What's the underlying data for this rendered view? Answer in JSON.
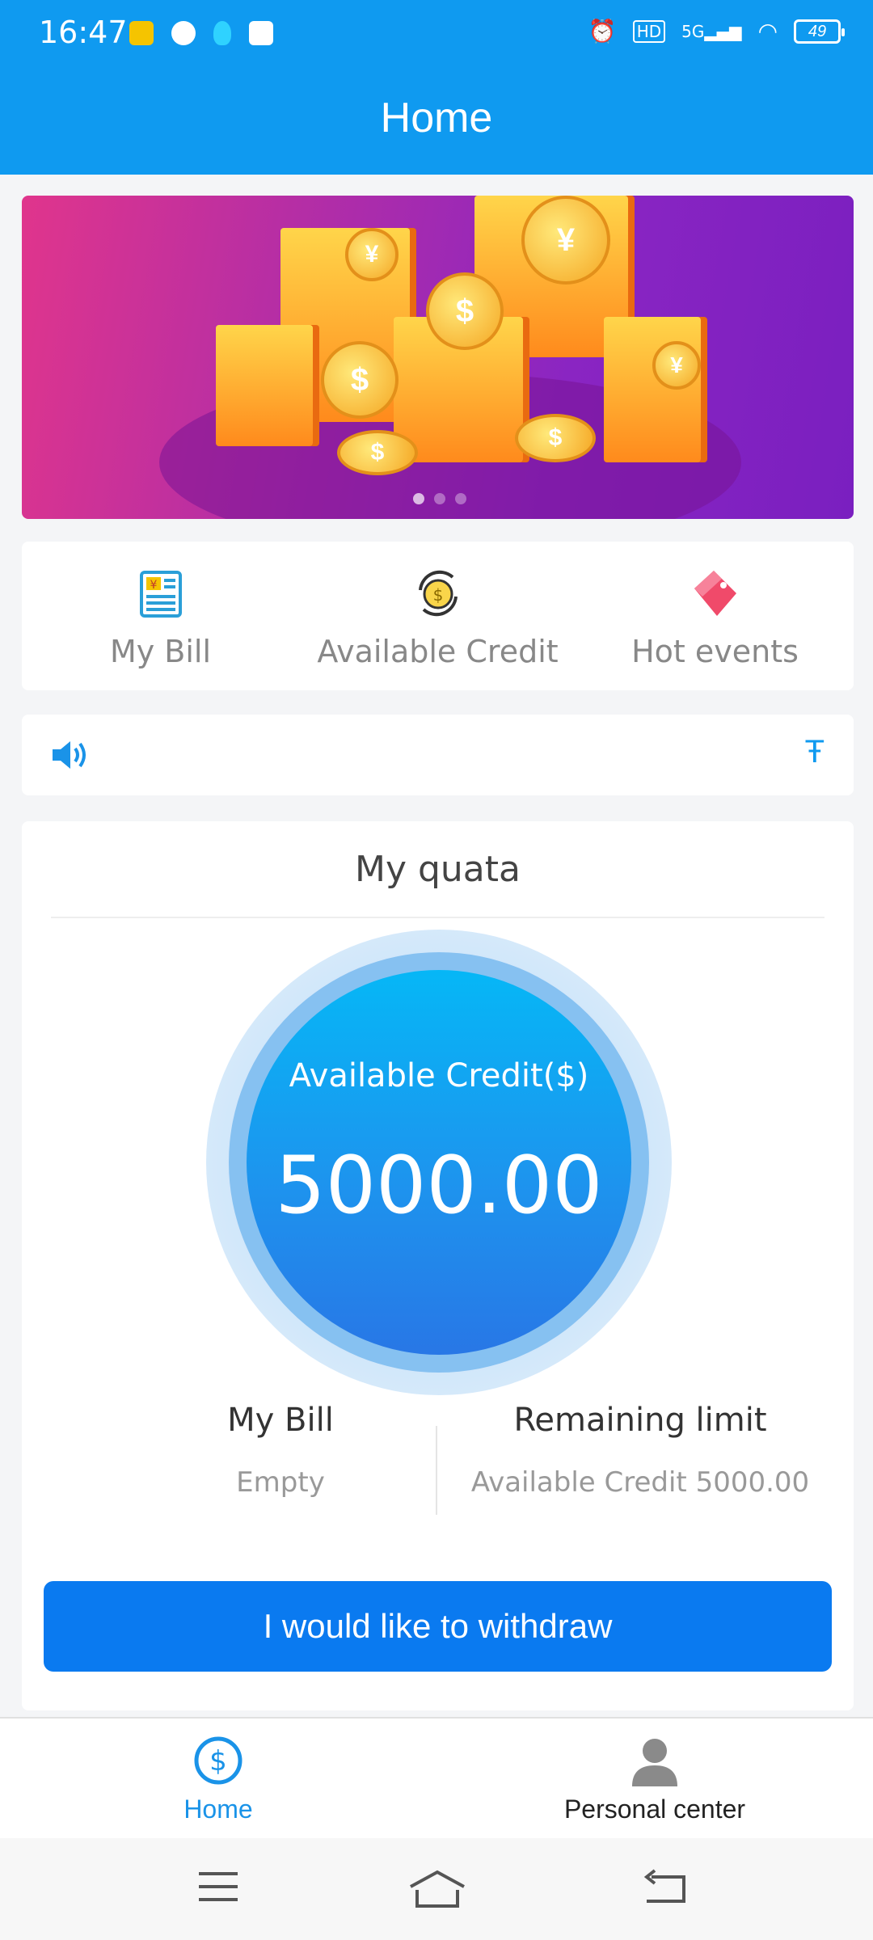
{
  "status_bar": {
    "time": "16:47",
    "signal": "5G",
    "hd": "HD",
    "battery": "49"
  },
  "header": {
    "title": "Home"
  },
  "banner": {
    "page_count": 3,
    "active_index": 0
  },
  "quick_links": [
    {
      "label": "My Bill",
      "icon": "bill-icon"
    },
    {
      "label": "Available Credit",
      "icon": "coin-cycle-icon"
    },
    {
      "label": "Hot events",
      "icon": "tag-icon"
    }
  ],
  "notice": {
    "icon": "speaker-icon",
    "text": "Ŧ"
  },
  "quota": {
    "title": "My quata",
    "circle_label": "Available Credit($)",
    "circle_amount": "5000.00",
    "left": {
      "title": "My Bill",
      "value": "Empty"
    },
    "right": {
      "title": "Remaining limit",
      "value": "Available Credit 5000.00"
    },
    "button": "I would like to withdraw"
  },
  "tabbar": [
    {
      "label": "Home",
      "icon": "dollar-circle-icon",
      "active": true
    },
    {
      "label": "Personal center",
      "icon": "person-icon",
      "active": false
    }
  ],
  "colors": {
    "primary": "#0f9af0",
    "button": "#0a7af0",
    "circle_top": "#06b7f6",
    "circle_bottom": "#2877e6"
  }
}
